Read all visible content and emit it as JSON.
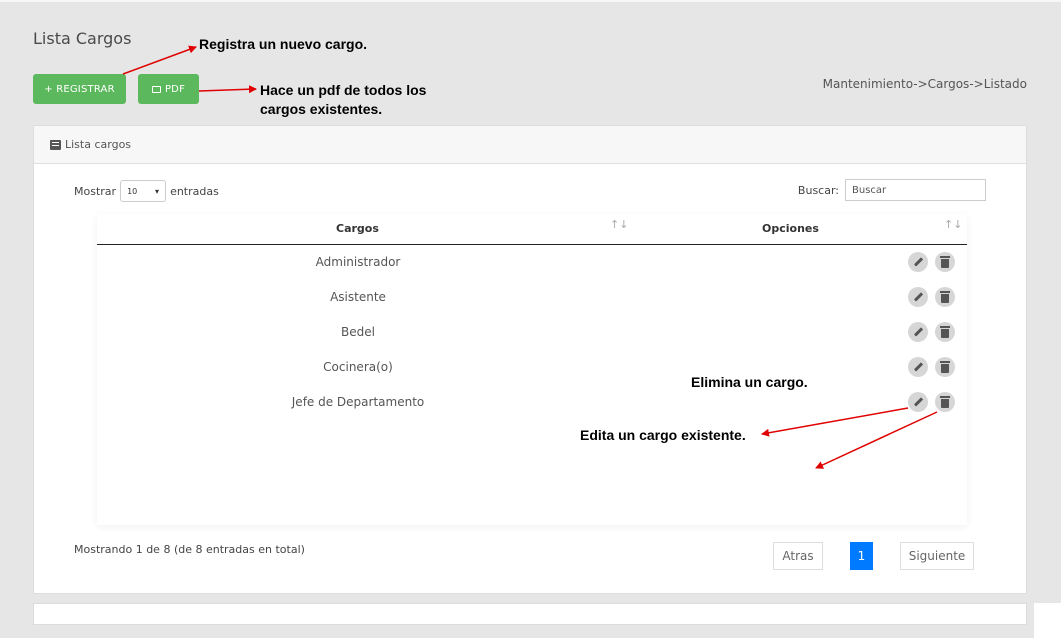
{
  "page": {
    "title": "Lista Cargos",
    "breadcrumb": "Mantenimiento->Cargos->Listado"
  },
  "toolbar": {
    "register_label": "+ REGISTRAR",
    "pdf_label": "PDF"
  },
  "card": {
    "title": "Lista cargos"
  },
  "length": {
    "prefix": "Mostrar",
    "value": "10",
    "suffix": "entradas"
  },
  "search": {
    "label": "Buscar:",
    "placeholder": "Buscar"
  },
  "table": {
    "headers": {
      "cargos": "Cargos",
      "opciones": "Opciones"
    },
    "rows": [
      "Administrador",
      "Asistente",
      "Bedel",
      "Cocinera(o)",
      "Jefe de Departamento"
    ]
  },
  "pagination": {
    "info": "Mostrando 1 de 8 (de 8 entradas en total)",
    "prev": "Atras",
    "current": "1",
    "next": "Siguiente"
  },
  "annotations": {
    "register": "Registra un nuevo cargo.",
    "pdf": "Hace un pdf de todos los cargos existentes.",
    "delete": "Elimina un cargo.",
    "edit": "Edita un cargo existente."
  },
  "colors": {
    "accent_green": "#5cb85c",
    "page_active": "#007bff",
    "annotation_arrow": "#e00000"
  },
  "icons": {
    "pdf": "copy-icon",
    "card": "list-icon",
    "edit": "pencil-icon",
    "delete": "trash-icon",
    "sort": "sort-icon"
  }
}
